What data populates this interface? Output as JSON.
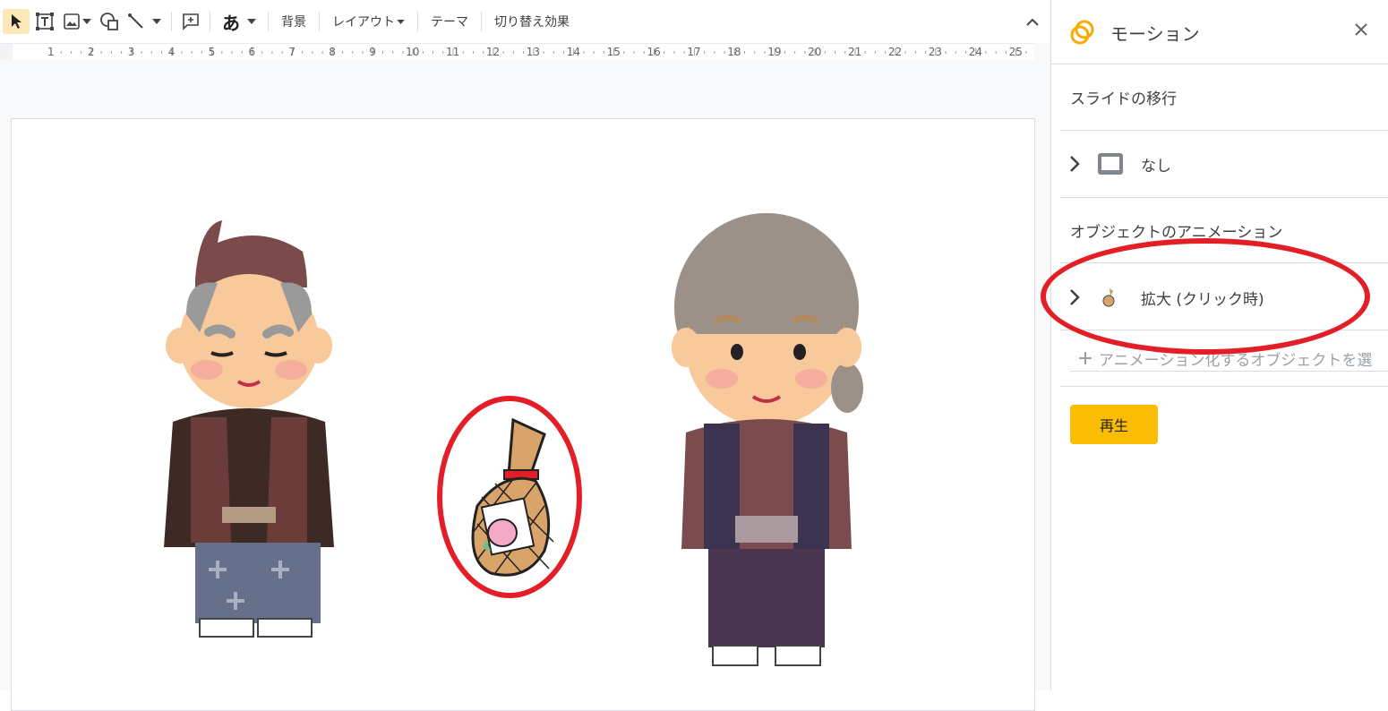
{
  "toolbar": {
    "background_label": "背景",
    "layout_label": "レイアウト",
    "theme_label": "テーマ",
    "transition_label": "切り替え効果",
    "text_style_label": "あ"
  },
  "ruler": {
    "numbers": [
      "1",
      "2",
      "3",
      "4",
      "5",
      "6",
      "7",
      "8",
      "9",
      "10",
      "11",
      "12",
      "13",
      "14",
      "15",
      "16",
      "17",
      "18",
      "19",
      "20",
      "21",
      "22",
      "23",
      "24",
      "25"
    ]
  },
  "panel": {
    "title": "モーション",
    "slide_transition_heading": "スライドの移行",
    "transition_value": "なし",
    "object_animation_heading": "オブジェクトのアニメーション",
    "animation_item": "拡大 (クリック時)",
    "add_placeholder": "アニメーション化するオブジェクトを選",
    "play_label": "再生"
  },
  "colors": {
    "accent": "#fbbc04",
    "annotation_red": "#e41e26"
  }
}
